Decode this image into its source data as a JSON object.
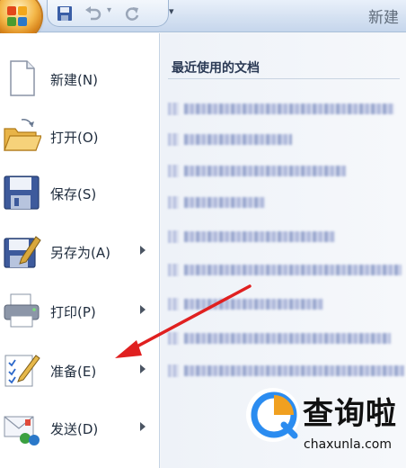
{
  "window": {
    "doc_title": "新建"
  },
  "quick_access": {
    "icons": [
      "office-button",
      "save-icon",
      "undo-icon",
      "redo-icon",
      "customize-dropdown-icon"
    ],
    "dropdown_glyph": "▾"
  },
  "menu": {
    "items": [
      {
        "label": "新建(N)",
        "icon": "new-document-icon",
        "has_submenu": false
      },
      {
        "label": "打开(O)",
        "icon": "open-folder-icon",
        "has_submenu": false
      },
      {
        "label": "保存(S)",
        "icon": "save-floppy-icon",
        "has_submenu": false
      },
      {
        "label": "另存为(A)",
        "icon": "save-as-icon",
        "has_submenu": true
      },
      {
        "label": "打印(P)",
        "icon": "printer-icon",
        "has_submenu": true
      },
      {
        "label": "准备(E)",
        "icon": "prepare-icon",
        "has_submenu": true
      },
      {
        "label": "发送(D)",
        "icon": "send-icon",
        "has_submenu": true
      }
    ]
  },
  "recent": {
    "header": "最近使用的文档",
    "items_count_note": "entries are pixelated/unreadable"
  },
  "annotation": {
    "arrow_color": "#e02020",
    "target": "准备(E)"
  },
  "watermark": {
    "brand_cn": "查询啦",
    "brand_en": "chaxunla.com",
    "accent": "#2b8cf0"
  },
  "colors": {
    "menu_bg": "#ffffff",
    "recent_bg": "#eef2f8",
    "title_bar": "#d3e0f1"
  }
}
